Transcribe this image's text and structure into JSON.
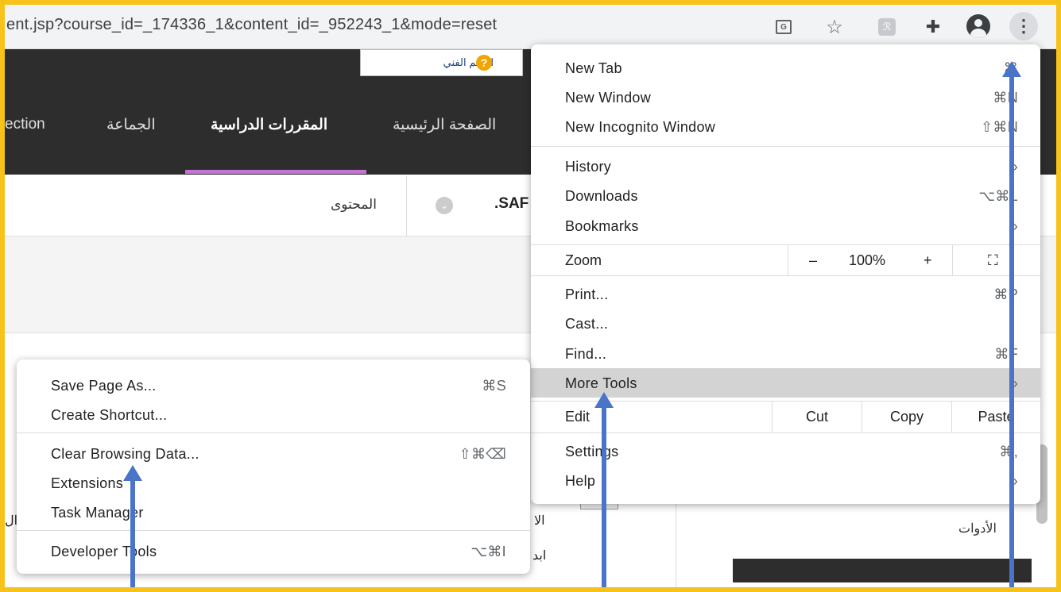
{
  "browser": {
    "url": "ent.jsp?course_id=_174336_1&content_id=_952243_1&mode=reset",
    "icons": [
      "translate-icon",
      "star-icon",
      "extension-icon",
      "puzzle-icon",
      "profile-icon",
      "kebab-menu-icon"
    ],
    "ext_letter": "ℛ"
  },
  "page": {
    "support_label": "الدعم الفني",
    "nav": {
      "home": "الصفحة الرئيسية",
      "courses": "المقررات الدراسية",
      "community": "الجماعة",
      "partial": "ection"
    },
    "content_label": "المحتوى",
    "course_code": ".SAF",
    "tools_label": "الأدوات",
    "frag1": "ال",
    "frag2": "الا",
    "frag3": "ابد"
  },
  "chrome_menu": {
    "new_tab": {
      "label": "New Tab",
      "shortcut": "⌘"
    },
    "new_window": {
      "label": "New Window",
      "shortcut": "⌘N"
    },
    "new_incognito": {
      "label": "New Incognito Window",
      "shortcut": "⇧⌘N"
    },
    "history": {
      "label": "History",
      "shortcut": "›"
    },
    "downloads": {
      "label": "Downloads",
      "shortcut": "⌥⌘L"
    },
    "bookmarks": {
      "label": "Bookmarks",
      "shortcut": "›"
    },
    "zoom": {
      "label": "Zoom",
      "minus": "–",
      "level": "100%",
      "plus": "+",
      "fullscreen": "⛶"
    },
    "print": {
      "label": "Print...",
      "shortcut": "⌘P"
    },
    "cast": {
      "label": "Cast..."
    },
    "find": {
      "label": "Find...",
      "shortcut": "⌘F"
    },
    "more_tools": {
      "label": "More Tools",
      "shortcut": "›"
    },
    "edit": {
      "label": "Edit",
      "cut": "Cut",
      "copy": "Copy",
      "paste": "Paste"
    },
    "settings": {
      "label": "Settings",
      "shortcut": "⌘,"
    },
    "help": {
      "label": "Help",
      "shortcut": "›"
    }
  },
  "more_tools_menu": {
    "save_page": {
      "label": "Save Page As...",
      "shortcut": "⌘S"
    },
    "create_shortcut": {
      "label": "Create Shortcut..."
    },
    "clear_data": {
      "label": "Clear Browsing Data...",
      "shortcut": "⇧⌘⌫"
    },
    "extensions": {
      "label": "Extensions"
    },
    "task_manager": {
      "label": "Task Manager"
    },
    "developer_tools": {
      "label": "Developer Tools",
      "shortcut": "⌥⌘I"
    }
  },
  "colors": {
    "frame": "#f7c21a",
    "arrow": "#4a74c8",
    "header_bg": "#2d2d2d",
    "nav_accent": "#c472d3",
    "highlight": "#d3d3d3"
  }
}
